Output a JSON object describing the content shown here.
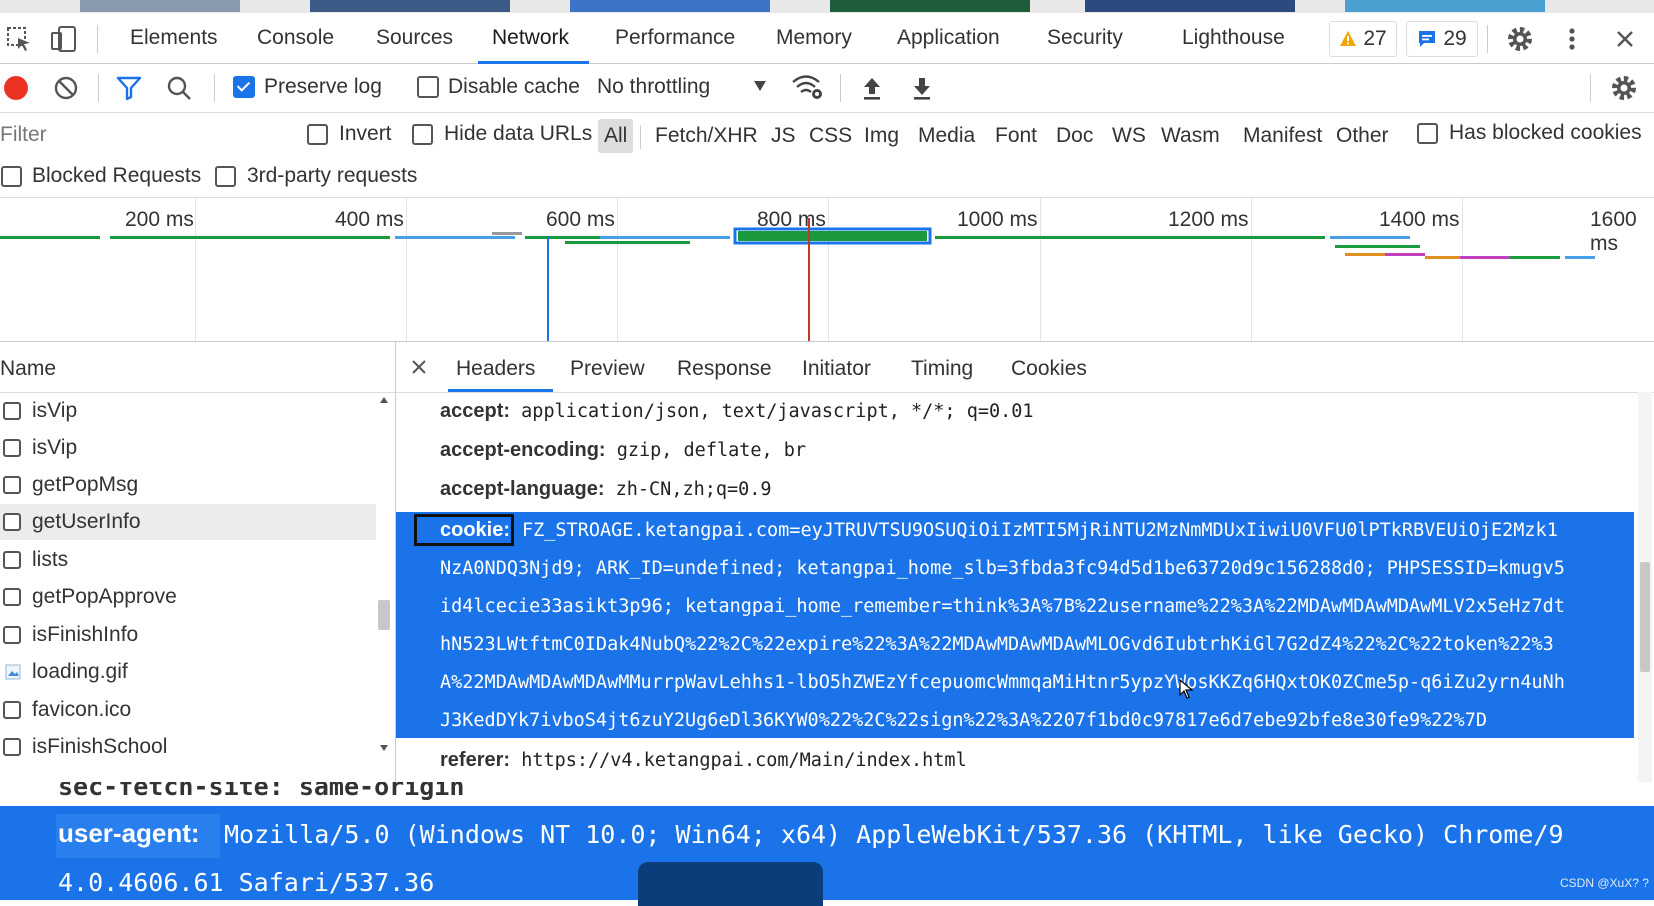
{
  "tabs": [
    "Elements",
    "Console",
    "Sources",
    "Network",
    "Performance",
    "Memory",
    "Application",
    "Security",
    "Lighthouse"
  ],
  "active_tab": "Network",
  "badges": {
    "warnings": "27",
    "messages": "29"
  },
  "toolbar": {
    "preserve_log": "Preserve log",
    "disable_cache": "Disable cache",
    "throttling": "No throttling"
  },
  "filter": {
    "placeholder": "Filter",
    "invert": "Invert",
    "hide_data_urls": "Hide data URLs",
    "types": [
      "All",
      "Fetch/XHR",
      "JS",
      "CSS",
      "Img",
      "Media",
      "Font",
      "Doc",
      "WS",
      "Wasm",
      "Manifest",
      "Other"
    ],
    "has_blocked_cookies": "Has blocked cookies",
    "blocked_requests": "Blocked Requests",
    "third_party": "3rd-party requests"
  },
  "timeline": {
    "ticks": [
      "200 ms",
      "400 ms",
      "600 ms",
      "800 ms",
      "1000 ms",
      "1200 ms",
      "1400 ms",
      "1600 ms"
    ]
  },
  "requests": {
    "header": "Name",
    "items": [
      "isVip",
      "isVip",
      "getPopMsg",
      "getUserInfo",
      "lists",
      "getPopApprove",
      "isFinishInfo",
      "loading.gif",
      "favicon.ico",
      "isFinishSchool"
    ],
    "selected_index": 3
  },
  "detail": {
    "tabs": [
      "Headers",
      "Preview",
      "Response",
      "Initiator",
      "Timing",
      "Cookies"
    ],
    "active": "Headers",
    "accept": {
      "name": "accept:",
      "value": "application/json, text/javascript, */*; q=0.01"
    },
    "accept_encoding": {
      "name": "accept-encoding:",
      "value": "gzip, deflate, br"
    },
    "accept_language": {
      "name": "accept-language:",
      "value": "zh-CN,zh;q=0.9"
    },
    "cookie": {
      "name": "cookie:",
      "lines": [
        "FZ_STROAGE.ketangpai.com=eyJTRUVTSU9OSUQiOiIzMTI5MjRiNTU2MzNmMDUxIiwiU0VFU0lPTkRBVEUiOjE2Mzk1",
        "NzA0NDQ3Njd9; ARK_ID=undefined; ketangpai_home_slb=3fbda3fc94d5d1be63720d9c156288d0; PHPSESSID=kmugv5",
        "id4lcecie33asikt3p96; ketangpai_home_remember=think%3A%7B%22username%22%3A%22MDAwMDAwMDAwMLV2x5eHz7dt",
        "hN523LWtftmC0IDak4NubQ%22%2C%22expire%22%3A%22MDAwMDAwMDAwMLOGvd6IubtrhKiGl7G2dZ4%22%2C%22token%22%3",
        "A%22MDAwMDAwMDAwMMurrpWavLehhs1-lbO5hZWEzYfcepuomcWmmqaMiHtnr5ypzYWosKKZq6HQxtOK0ZCme5p-q6iZu2yrn4uNh",
        "J3KedDYk7ivboS4jt6zuY2Ug6eDl36KYW0%22%2C%22sign%22%3A%2207f1bd0c97817e6d7ebe92bfe8e30fe9%22%7D"
      ]
    },
    "referer": {
      "name": "referer:",
      "value": "https://v4.ketangpai.com/Main/index.html"
    }
  },
  "overlay": {
    "cut_line": "sec-fetch-site: same-origin",
    "ua_name": "user-agent:",
    "ua_line1": "Mozilla/5.0 (Windows NT 10.0; Win64; x64) AppleWebKit/537.36 (KHTML, like Gecko) Chrome/9",
    "ua_line2": "4.0.4606.61 Safari/537.36",
    "watermark": "CSDN @XuX? ?"
  }
}
